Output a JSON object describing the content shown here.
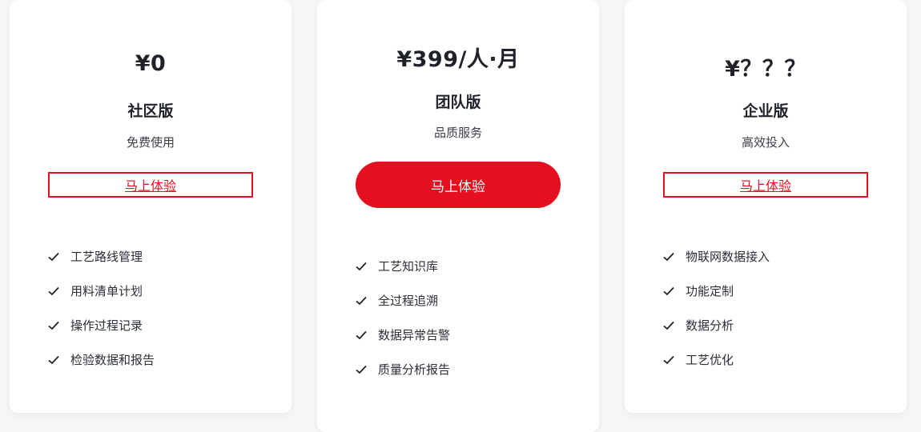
{
  "plans": [
    {
      "price": "¥0",
      "name": "社区版",
      "desc": "免费使用",
      "cta": "马上体验",
      "features": [
        "工艺路线管理",
        "用料清单计划",
        "操作过程记录",
        "检验数据和报告"
      ]
    },
    {
      "price": "¥399/人·月",
      "name": "团队版",
      "desc": "品质服务",
      "cta": "马上体验",
      "features": [
        "工艺知识库",
        "全过程追溯",
        "数据异常告警",
        "质量分析报告"
      ]
    },
    {
      "price": "¥？？？",
      "name": "企业版",
      "desc": "高效投入",
      "cta": "马上体验",
      "features": [
        "物联网数据接入",
        "功能定制",
        "数据分析",
        "工艺优化"
      ]
    }
  ],
  "colors": {
    "accent": "#e60f1f",
    "text": "#1f2329"
  },
  "icons": {
    "feature_bullet": "checkmark-icon"
  }
}
